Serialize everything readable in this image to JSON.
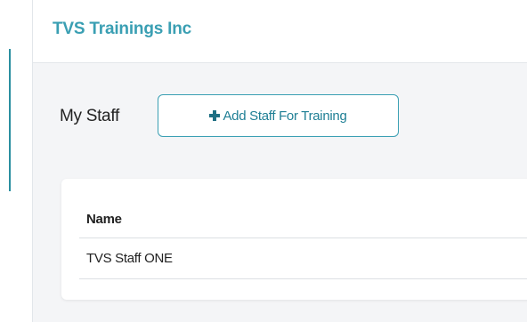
{
  "header": {
    "org_name": "TVS Trainings Inc"
  },
  "staff_section": {
    "title": "My Staff",
    "add_button_label": "Add Staff For Training",
    "add_button_icon": "plus-icon"
  },
  "staff_table": {
    "columns": [
      "Name"
    ],
    "rows": [
      [
        "TVS Staff ONE"
      ]
    ]
  },
  "colors": {
    "accent": "#3a9fb3",
    "button_text": "#1f7f95",
    "page_background": "#f4f5f7"
  }
}
